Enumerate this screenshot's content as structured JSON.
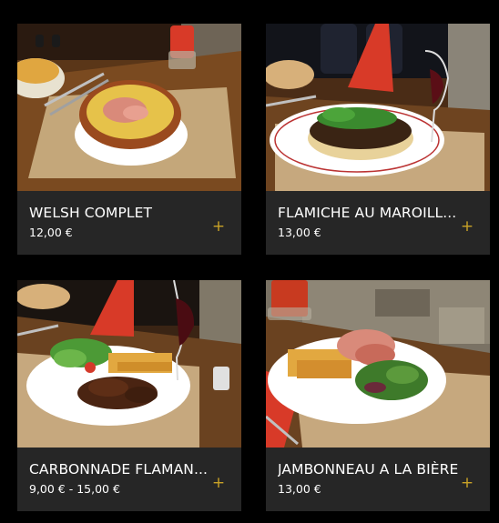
{
  "menu": {
    "items": [
      {
        "name": "WELSH COMPLET",
        "price": "12,00 €"
      },
      {
        "name": "FLAMICHE AU MAROILL...",
        "price": "13,00 €"
      },
      {
        "name": "CARBONNADE FLAMAN...",
        "price": "9,00 € - 15,00 €"
      },
      {
        "name": "JAMBONNEAU A LA BIÈRE",
        "price": "13,00 €"
      }
    ],
    "add_symbol": "+"
  },
  "colors": {
    "background": "#000000",
    "card": "#262626",
    "text": "#ffffff",
    "accent": "#c9a227"
  },
  "icons": {
    "add": "plus-icon"
  }
}
